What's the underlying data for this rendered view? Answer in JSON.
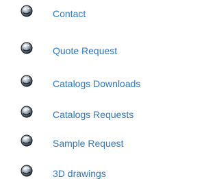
{
  "menu": {
    "items": [
      {
        "label": "Contact",
        "icon": "globe-bullet-icon"
      },
      {
        "label": "Quote Request",
        "icon": "globe-bullet-icon"
      },
      {
        "label": "Catalogs Downloads",
        "icon": "globe-bullet-icon"
      },
      {
        "label": "Catalogs Requests",
        "icon": "globe-bullet-icon"
      },
      {
        "label": "Sample Request",
        "icon": "globe-bullet-icon"
      },
      {
        "label": "3D drawings",
        "icon": "globe-bullet-icon"
      }
    ]
  },
  "colors": {
    "link": "#2f76c2",
    "background": "#ffffff",
    "icon_dark": "#1f2d3a",
    "icon_highlight": "#ffffff"
  }
}
